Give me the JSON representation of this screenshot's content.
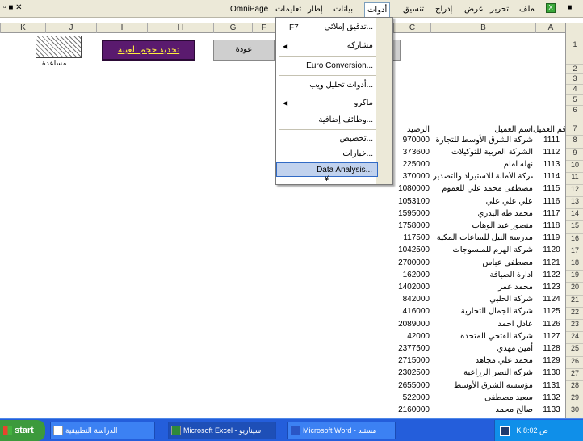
{
  "menubar": {
    "items": [
      "OmniPage",
      "تعليمات",
      "إطار",
      "بيانات",
      "أدوات",
      "تنسيق",
      "إدراج",
      "عرض",
      "تحرير",
      "ملف"
    ],
    "active_index": 4
  },
  "columns": [
    "K",
    "J",
    "I",
    "H",
    "G",
    "F",
    "C",
    "B",
    "A"
  ],
  "rows": [
    "1",
    "2",
    "3",
    "4",
    "5",
    "6",
    "7",
    "8",
    "9",
    "10",
    "11",
    "12",
    "13",
    "14",
    "15",
    "16",
    "17",
    "18",
    "19",
    "20",
    "21",
    "22",
    "23",
    "24",
    "25",
    "26",
    "27",
    "28",
    "29",
    "30"
  ],
  "sheet": {
    "purple_button": "تحديد حجم العينة",
    "gray_button": "عودة",
    "hatch_label": "مساعدة",
    "header_code": "رقم العميل",
    "header_name": "اسم العميل",
    "header_balance": "الرصيد",
    "records": [
      {
        "code": "1111",
        "name": "شركة الشرق الأوسط للتجارة",
        "balance": "970000"
      },
      {
        "code": "1112",
        "name": "الشركة العربية للتوكيلات",
        "balance": "373600"
      },
      {
        "code": "1113",
        "name": "نهله امام",
        "balance": "225000"
      },
      {
        "code": "1114",
        "name": "شركة الأمانة للاستيراد والتصدير",
        "balance": "370000"
      },
      {
        "code": "1115",
        "name": "مصطفى محمد علي للعموم",
        "balance": "1080000"
      },
      {
        "code": "1116",
        "name": "علي علي علي",
        "balance": "1053100"
      },
      {
        "code": "1117",
        "name": "محمد طه البدري",
        "balance": "1595000"
      },
      {
        "code": "1118",
        "name": "منصور عبد الوهاب",
        "balance": "1758000"
      },
      {
        "code": "1119",
        "name": "مدرسة النيل للساعات المكية",
        "balance": "117500"
      },
      {
        "code": "1120",
        "name": "شركة الهرم للمنسوجات",
        "balance": "1042500"
      },
      {
        "code": "1121",
        "name": "مصطفى عباس",
        "balance": "2700000"
      },
      {
        "code": "1122",
        "name": "ادارة الضيافة",
        "balance": "162000"
      },
      {
        "code": "1123",
        "name": "محمد عمر",
        "balance": "1402000"
      },
      {
        "code": "1124",
        "name": "شركة الحلبي",
        "balance": "842000"
      },
      {
        "code": "1125",
        "name": "شركة الجمال التجارية",
        "balance": "416000"
      },
      {
        "code": "1126",
        "name": "عادل احمد",
        "balance": "2089000"
      },
      {
        "code": "1127",
        "name": "شركة الفتحي المتحدة",
        "balance": "42000"
      },
      {
        "code": "1128",
        "name": "أمين مهدي",
        "balance": "2377500"
      },
      {
        "code": "1129",
        "name": "محمد علي مجاهد",
        "balance": "2715000"
      },
      {
        "code": "1130",
        "name": "شركة النصر الزراعية",
        "balance": "2302500"
      },
      {
        "code": "1131",
        "name": "مؤسسة الشرق الأوسط",
        "balance": "2655000"
      },
      {
        "code": "1132",
        "name": "سعيد مصطفى",
        "balance": "522000"
      },
      {
        "code": "1133",
        "name": "صالح محمد",
        "balance": "2160000"
      }
    ]
  },
  "dropdown": {
    "items": [
      {
        "label": "تدقيق إملائي...",
        "shortcut": "F7",
        "arrow": false,
        "highlight": false
      },
      {
        "label": "مشاركة",
        "shortcut": "",
        "arrow": true,
        "highlight": false
      },
      {
        "label": "Euro Conversion...",
        "shortcut": "",
        "arrow": false,
        "highlight": false
      },
      {
        "label": "أدوات تحليل ويب...",
        "shortcut": "",
        "arrow": false,
        "highlight": false
      },
      {
        "label": "ماكرو",
        "shortcut": "",
        "arrow": true,
        "highlight": false
      },
      {
        "label": "وظائف إضافية...",
        "shortcut": "",
        "arrow": false,
        "highlight": false
      },
      {
        "label": "تخصيص...",
        "shortcut": "",
        "arrow": false,
        "highlight": false
      },
      {
        "label": "خيارات...",
        "shortcut": "",
        "arrow": false,
        "highlight": false
      },
      {
        "label": "Data Analysis...",
        "shortcut": "",
        "arrow": false,
        "highlight": true
      }
    ],
    "more_glyph": "¥"
  },
  "taskbar": {
    "start_label": "start",
    "tasks": [
      {
        "label": "الدراسة التطبيقية",
        "active": false
      },
      {
        "label": "Microsoft Excel - سيناريو",
        "active": true
      },
      {
        "label": "Microsoft Word - مستند",
        "active": false
      }
    ],
    "tray_text": "K 8:02 ص"
  },
  "colors": {
    "purple_button_bg": "#5a1a6e",
    "purple_button_text": "#ffef3c",
    "menu_highlight": "#c1d2ee",
    "taskbar": "#245edb"
  }
}
